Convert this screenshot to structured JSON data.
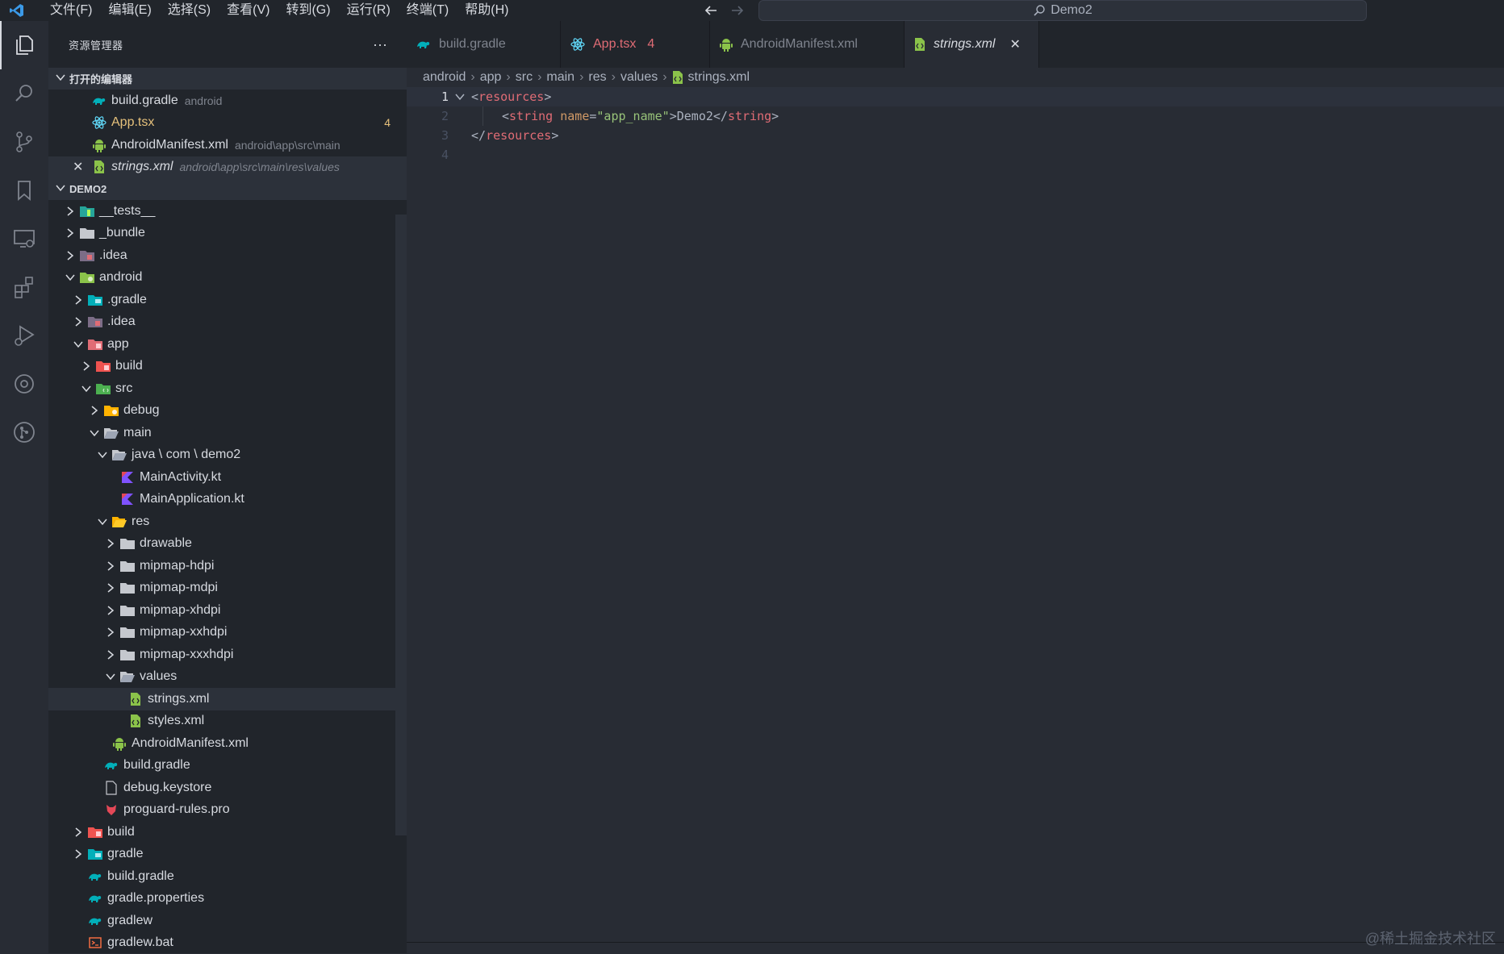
{
  "menu": [
    "文件(F)",
    "编辑(E)",
    "选择(S)",
    "查看(V)",
    "转到(G)",
    "运行(R)",
    "终端(T)",
    "帮助(H)"
  ],
  "search": {
    "label": "Demo2"
  },
  "sidebar": {
    "title": "资源管理器",
    "more": "···",
    "open_editors_title": "打开的编辑器",
    "open_editors": [
      {
        "label": "build.gradle",
        "desc": "android"
      },
      {
        "label": "App.tsx",
        "badge": "4"
      },
      {
        "label": "AndroidManifest.xml",
        "desc": "android\\app\\src\\main"
      },
      {
        "label": "strings.xml",
        "desc": "android\\app\\src\\main\\res\\values"
      }
    ],
    "project_title": "DEMO2",
    "tree": [
      "__tests__",
      "_bundle",
      ".idea",
      "android",
      ".gradle",
      ".idea",
      "app",
      "build",
      "src",
      "debug",
      "main",
      "java \\ com \\ demo2",
      "MainActivity.kt",
      "MainApplication.kt",
      "res",
      "drawable",
      "mipmap-hdpi",
      "mipmap-mdpi",
      "mipmap-xhdpi",
      "mipmap-xxhdpi",
      "mipmap-xxxhdpi",
      "values",
      "strings.xml",
      "styles.xml",
      "AndroidManifest.xml",
      "build.gradle",
      "debug.keystore",
      "proguard-rules.pro",
      "build",
      "gradle",
      "build.gradle",
      "gradle.properties",
      "gradlew",
      "gradlew.bat"
    ]
  },
  "tabs": [
    {
      "label": "build.gradle"
    },
    {
      "label": "App.tsx",
      "badge": "4"
    },
    {
      "label": "AndroidManifest.xml"
    },
    {
      "label": "strings.xml",
      "close": "✕"
    }
  ],
  "breadcrumb": [
    "android",
    "app",
    "src",
    "main",
    "res",
    "values",
    "strings.xml"
  ],
  "code": {
    "line_numbers": [
      "1",
      "2",
      "3",
      "4"
    ],
    "l1": {
      "open": "<",
      "tag": "resources",
      "close": ">"
    },
    "l2": {
      "open": "<",
      "tag": "string",
      "attr": "name",
      "eq": "=",
      "value": "\"app_name\"",
      "gt": ">",
      "text": "Demo2",
      "endopen": "</",
      "endtag": "string",
      "endclose": ">"
    },
    "l3": {
      "open": "</",
      "tag": "resources",
      "close": ">"
    }
  },
  "watermark": "@稀土掘金技术社区",
  "colors": {
    "accent_green": "#8bc34a",
    "error_orange": "#e06c75",
    "gradle_teal": "#02afb9",
    "react_blue": "#61dafb"
  }
}
